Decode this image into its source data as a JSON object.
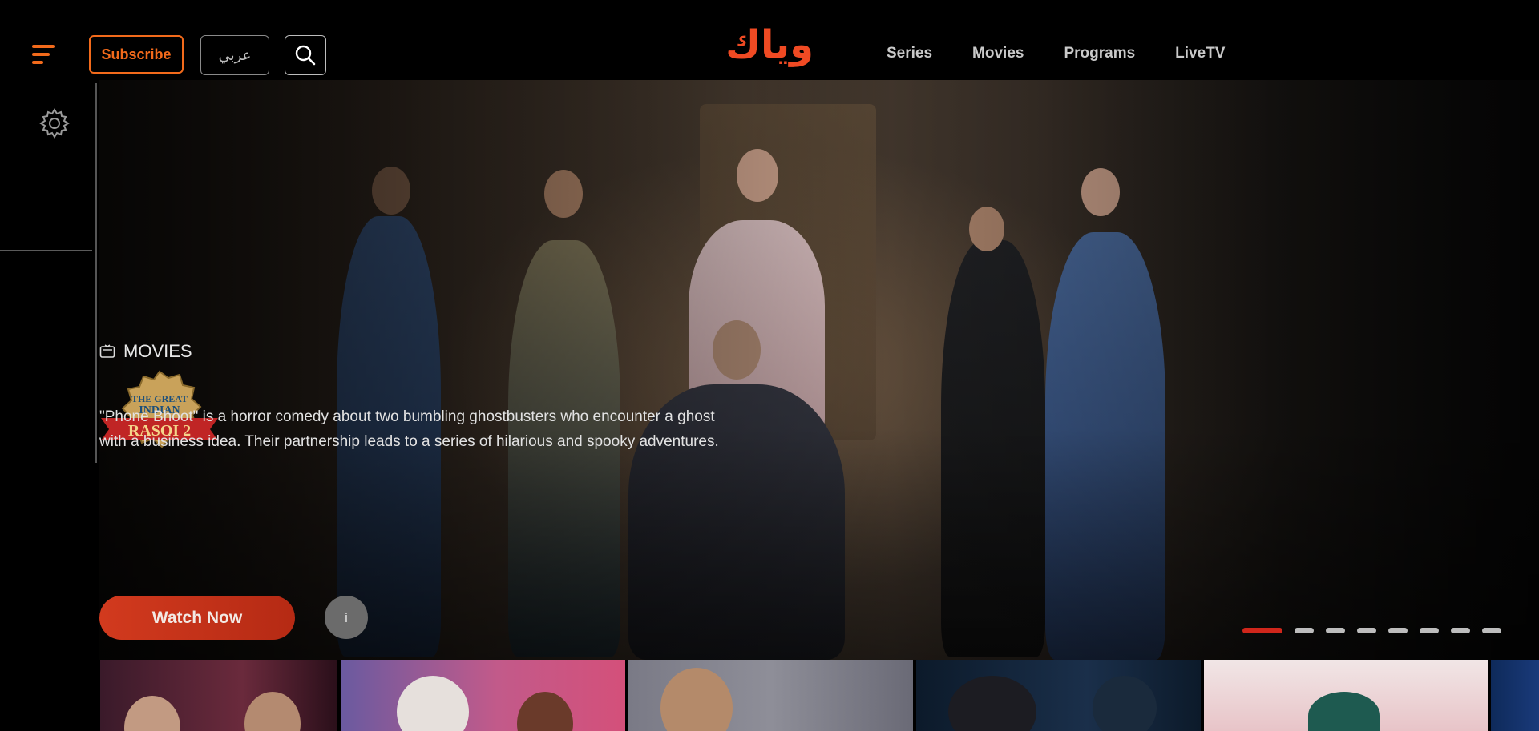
{
  "header": {
    "subscribe_label": "Subscribe",
    "language_label": "عربي",
    "logo_text": "وياك",
    "nav": [
      {
        "label": "Series"
      },
      {
        "label": "Movies"
      },
      {
        "label": "Programs"
      },
      {
        "label": "LiveTV"
      }
    ]
  },
  "hero": {
    "category_label": "MOVIES",
    "show_logo_text": [
      "THE GREAT",
      "INDIAN",
      "RASOI 2"
    ],
    "description": "\"Phone Bhoot\" is a horror comedy about two bumbling ghostbusters who encounter a ghost with a business idea. Their partnership leads to a series of hilarious and spooky adventures.",
    "watch_now_label": "Watch Now",
    "info_label": "i",
    "slide_count": 8,
    "active_slide": 1
  },
  "colors": {
    "accent": "#f26a1b",
    "logo": "#f04a23",
    "watch_button": "#c8321a",
    "active_dot": "#d0261b"
  },
  "icons": [
    "menu-icon",
    "search-icon",
    "gear-icon",
    "tv-icon",
    "info-icon"
  ]
}
